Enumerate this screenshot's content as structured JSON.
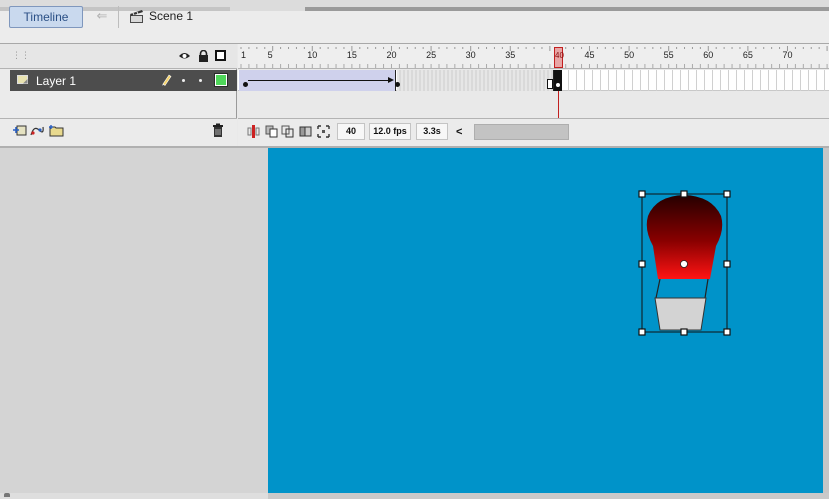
{
  "timeline_tab": {
    "label": "Timeline"
  },
  "scene": {
    "label": "Scene 1"
  },
  "layers": [
    {
      "name": "Layer 1"
    }
  ],
  "ruler": {
    "numbers": [
      "1",
      "5",
      "10",
      "15",
      "20",
      "25",
      "30",
      "35",
      "40",
      "45",
      "50",
      "55",
      "60",
      "65",
      "70"
    ]
  },
  "playhead": {
    "frame_label": "40"
  },
  "status": {
    "current_frame": "40",
    "frame_rate": "12.0 fps",
    "elapsed": "3.3s",
    "scroll_left": "<"
  },
  "colors": {
    "stage": "#0093c9",
    "layer_outline": "#4fd65a",
    "balloon_top": "#2a0000",
    "balloon_bottom": "#ff1a1a",
    "basket": "#d3d3d3"
  },
  "icons": {
    "back": "arrow-left-icon",
    "scene": "clapperboard-icon",
    "eye": "eye-icon",
    "lock": "lock-icon",
    "outline": "outline-icon",
    "layer": "layer-icon",
    "pencil": "pencil-icon",
    "new_layer": "new-layer-icon",
    "motion_guide": "motion-guide-icon",
    "new_folder": "new-folder-icon",
    "trash": "trash-icon",
    "center_frame": "center-frame-icon",
    "onion_skin": "onion-skin-icon",
    "onion_outline": "onion-skin-outline-icon",
    "edit_multiple": "edit-multiple-frames-icon",
    "modify_markers": "modify-markers-icon"
  }
}
